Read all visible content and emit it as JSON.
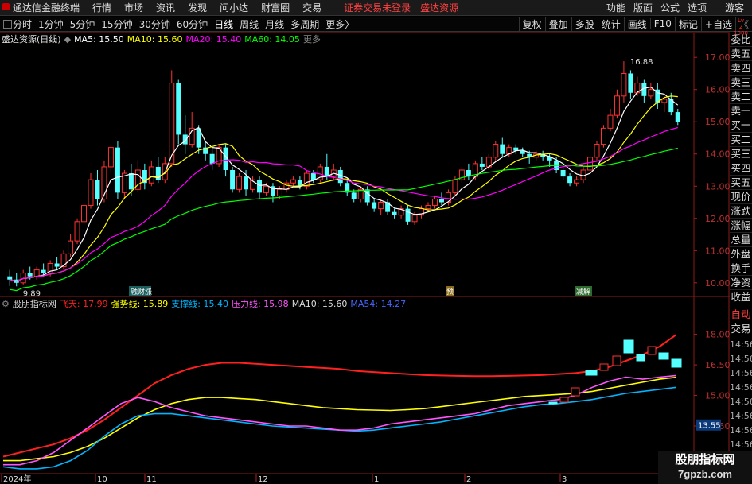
{
  "menu": {
    "app_title": "通达信金融终端",
    "items": [
      "行情",
      "市场",
      "资讯",
      "发现",
      "问小达",
      "财富圈",
      "交易"
    ],
    "security_warning": "证券交易未登录",
    "broker": "盛达资源",
    "right_items": [
      "功能",
      "版面",
      "公式",
      "选项"
    ],
    "guest": "游客"
  },
  "toolbar": {
    "periods": [
      "分时",
      "1分钟",
      "5分钟",
      "15分钟",
      "30分钟",
      "60分钟",
      "日线",
      "周线",
      "月线",
      "多周期",
      "更多"
    ],
    "more_suffix": "〉",
    "active_period": "日线",
    "right_buttons": [
      "复权",
      "叠加",
      "多股",
      "统计",
      "画线",
      "F10",
      "标记",
      "+自选",
      "《"
    ]
  },
  "level2": [
    "Lv",
    "2",
    "1000"
  ],
  "main_legend": {
    "settings_icon": "gear-icon",
    "name": "盛达资源(日线)",
    "collapse_icon": "chevron-icon",
    "ma5_label": "MA5: 15.50",
    "ma10_label": "MA10: 15.60",
    "ma20_label": "MA20: 15.40",
    "ma60_label": "MA60: 14.05",
    "controls": "◇ ×"
  },
  "sub_legend": {
    "name": "股朋指标网",
    "feitian": "飞天: 17.99",
    "strong": "强势线: 15.89",
    "support": "支撑线: 15.40",
    "pressure": "压力线: 15.98",
    "ma10": "MA10: 15.60",
    "ma54": "MA54: 14.27",
    "controls": "◇ ×"
  },
  "side_panel": [
    "委比",
    "卖五",
    "卖四",
    "卖三",
    "卖二",
    "卖一",
    "买一",
    "买二",
    "买三",
    "买四",
    "买五",
    "现价",
    "涨跌",
    "涨幅",
    "总量",
    "外盘",
    "换手",
    "净资",
    "收益"
  ],
  "side_bottom": [
    "自动",
    "交易"
  ],
  "side_times": [
    "14:56",
    "14:56",
    "14:56",
    "14:56",
    "14:56",
    "14:56",
    "14:56",
    "14:56"
  ],
  "main_axis": [
    "17.00",
    "16.00",
    "15.00",
    "14.00",
    "13.00",
    "12.00",
    "11.00",
    "10.00"
  ],
  "sub_axis": [
    "18.00",
    "16.50",
    "15.00",
    "13.50",
    "12.00"
  ],
  "sub_current": "13.55",
  "annotations": {
    "high": "16.88",
    "low": "9.89",
    "marker1": "融财涨",
    "marker2": "预",
    "marker3": "减解"
  },
  "date_axis": [
    "2024年",
    "10",
    "11",
    "12",
    "1",
    "2",
    "3"
  ],
  "watermark": {
    "line1": "股朋指标网",
    "line2": "7gpzb.com"
  },
  "colors": {
    "up": "#ff3232",
    "down": "#54ffff",
    "ma5": "#ffffff",
    "ma10": "#ffff00",
    "ma20": "#ff00ff",
    "ma60": "#00ff00",
    "feitian": "#ff2020",
    "strong": "#ffff00",
    "support": "#00b4ff",
    "pressure": "#ff55ff"
  },
  "chart_data": [
    {
      "type": "candlestick",
      "title": "盛达资源(日线)",
      "y_range": [
        9.6,
        17.4
      ],
      "x_labels": [
        "2024年",
        "10",
        "11",
        "12",
        "1",
        "2",
        "3"
      ],
      "candles": [
        [
          10.2,
          10.1,
          10.4,
          9.9
        ],
        [
          10.1,
          10.0,
          10.3,
          9.89
        ],
        [
          10.0,
          10.3,
          10.4,
          9.95
        ],
        [
          10.3,
          10.2,
          10.5,
          10.1
        ],
        [
          10.2,
          10.4,
          10.5,
          10.1
        ],
        [
          10.4,
          10.3,
          10.6,
          10.2
        ],
        [
          10.3,
          10.6,
          10.7,
          10.2
        ],
        [
          10.6,
          10.5,
          10.8,
          10.4
        ],
        [
          10.5,
          10.9,
          11.0,
          10.4
        ],
        [
          10.9,
          11.3,
          11.5,
          10.8
        ],
        [
          11.3,
          11.9,
          12.0,
          11.2
        ],
        [
          11.9,
          12.4,
          12.6,
          11.7
        ],
        [
          12.4,
          13.2,
          13.4,
          12.3
        ],
        [
          13.2,
          12.6,
          13.5,
          12.4
        ],
        [
          12.6,
          13.6,
          13.8,
          12.5
        ],
        [
          13.6,
          14.2,
          14.3,
          13.4
        ],
        [
          14.2,
          12.8,
          14.4,
          12.6
        ],
        [
          12.8,
          13.4,
          13.5,
          12.6
        ],
        [
          13.4,
          12.9,
          13.7,
          12.7
        ],
        [
          12.9,
          13.5,
          13.8,
          12.8
        ],
        [
          13.5,
          13.1,
          13.7,
          12.9
        ],
        [
          13.1,
          13.6,
          13.8,
          13.0
        ],
        [
          13.6,
          13.2,
          13.9,
          13.1
        ],
        [
          13.2,
          13.7,
          13.9,
          13.1
        ],
        [
          13.7,
          16.2,
          16.6,
          13.6
        ],
        [
          16.2,
          14.6,
          16.3,
          14.3
        ],
        [
          14.6,
          14.3,
          15.2,
          14.0
        ],
        [
          14.3,
          14.8,
          15.3,
          14.2
        ],
        [
          14.8,
          14.2,
          14.9,
          14.0
        ],
        [
          14.2,
          14.0,
          14.4,
          13.8
        ],
        [
          14.0,
          13.7,
          14.2,
          13.5
        ],
        [
          13.7,
          14.2,
          14.3,
          13.6
        ],
        [
          14.2,
          13.5,
          14.3,
          13.3
        ],
        [
          13.5,
          12.9,
          13.6,
          12.8
        ],
        [
          12.9,
          13.3,
          13.4,
          12.8
        ],
        [
          13.3,
          12.9,
          13.5,
          12.7
        ],
        [
          12.9,
          13.2,
          13.3,
          12.8
        ],
        [
          13.2,
          12.8,
          13.3,
          12.6
        ],
        [
          12.8,
          13.0,
          13.1,
          12.7
        ],
        [
          13.0,
          12.7,
          13.1,
          12.5
        ],
        [
          12.7,
          12.9,
          13.0,
          12.6
        ],
        [
          12.9,
          13.1,
          13.2,
          12.8
        ],
        [
          13.1,
          13.2,
          13.3,
          13.0
        ],
        [
          13.2,
          13.0,
          13.3,
          12.9
        ],
        [
          13.0,
          13.4,
          13.5,
          12.9
        ],
        [
          13.4,
          13.2,
          13.5,
          13.1
        ],
        [
          13.2,
          13.6,
          13.7,
          13.1
        ],
        [
          13.6,
          13.3,
          14.0,
          13.2
        ],
        [
          13.3,
          13.5,
          13.7,
          13.2
        ],
        [
          13.5,
          13.1,
          13.6,
          13.0
        ],
        [
          13.1,
          12.8,
          13.2,
          12.7
        ],
        [
          12.8,
          12.6,
          12.9,
          12.5
        ],
        [
          12.6,
          12.9,
          13.0,
          12.5
        ],
        [
          12.9,
          12.5,
          13.0,
          12.4
        ],
        [
          12.5,
          12.3,
          12.6,
          12.2
        ],
        [
          12.3,
          12.5,
          12.6,
          12.1
        ],
        [
          12.5,
          12.2,
          12.6,
          12.1
        ],
        [
          12.2,
          12.1,
          12.3,
          12.0
        ],
        [
          12.1,
          12.3,
          12.4,
          12.0
        ],
        [
          12.3,
          11.9,
          12.4,
          11.8
        ],
        [
          11.9,
          12.1,
          12.2,
          11.8
        ],
        [
          12.1,
          12.3,
          12.4,
          12.0
        ],
        [
          12.3,
          12.4,
          12.5,
          12.2
        ],
        [
          12.4,
          12.6,
          12.7,
          12.3
        ],
        [
          12.6,
          12.5,
          12.8,
          12.4
        ],
        [
          12.5,
          12.8,
          12.9,
          12.4
        ],
        [
          12.8,
          13.2,
          13.3,
          12.7
        ],
        [
          13.2,
          13.5,
          13.6,
          13.1
        ],
        [
          13.5,
          13.3,
          13.7,
          13.2
        ],
        [
          13.3,
          13.7,
          13.8,
          13.2
        ],
        [
          13.7,
          13.6,
          13.9,
          13.5
        ],
        [
          13.6,
          13.9,
          14.0,
          13.5
        ],
        [
          13.9,
          14.3,
          14.4,
          13.8
        ],
        [
          14.3,
          14.0,
          14.5,
          13.9
        ],
        [
          14.0,
          14.2,
          14.3,
          13.9
        ],
        [
          14.2,
          14.1,
          14.3,
          14.0
        ],
        [
          14.1,
          14.0,
          14.2,
          13.9
        ],
        [
          14.0,
          13.9,
          14.1,
          13.7
        ],
        [
          13.9,
          14.0,
          14.1,
          13.8
        ],
        [
          14.0,
          13.9,
          14.1,
          13.8
        ],
        [
          13.9,
          13.8,
          14.0,
          13.6
        ],
        [
          13.8,
          13.5,
          13.9,
          13.4
        ],
        [
          13.5,
          13.3,
          13.6,
          13.2
        ],
        [
          13.3,
          13.1,
          13.4,
          13.0
        ],
        [
          13.1,
          13.2,
          13.3,
          13.0
        ],
        [
          13.2,
          13.5,
          13.6,
          13.1
        ],
        [
          13.5,
          13.9,
          14.0,
          13.4
        ],
        [
          13.9,
          14.3,
          14.4,
          13.8
        ],
        [
          14.3,
          14.8,
          14.9,
          14.2
        ],
        [
          14.8,
          15.2,
          15.4,
          14.7
        ],
        [
          15.2,
          15.8,
          16.0,
          15.1
        ],
        [
          15.8,
          16.5,
          16.88,
          15.6
        ],
        [
          16.5,
          15.9,
          16.6,
          15.7
        ],
        [
          15.9,
          16.2,
          16.4,
          15.8
        ],
        [
          16.2,
          15.8,
          16.3,
          15.6
        ],
        [
          15.8,
          16.0,
          16.2,
          15.7
        ],
        [
          16.0,
          15.6,
          16.2,
          15.4
        ],
        [
          15.6,
          15.7,
          15.8,
          15.3
        ],
        [
          15.7,
          15.3,
          15.9,
          15.2
        ],
        [
          15.3,
          15.0,
          15.4,
          14.9
        ]
      ]
    },
    {
      "type": "line",
      "title": "股朋指标网",
      "y_range": [
        11.2,
        19.0
      ],
      "series": [
        {
          "name": "飞天",
          "values": [
            12.0,
            12.2,
            12.4,
            12.6,
            12.9,
            13.3,
            13.8,
            14.4,
            15.0,
            15.6,
            16.0,
            16.3,
            16.5,
            16.6,
            16.6,
            16.55,
            16.5,
            16.45,
            16.4,
            16.35,
            16.3,
            16.2,
            16.15,
            16.1,
            16.05,
            16.0,
            15.98,
            15.96,
            15.95,
            15.95,
            15.96,
            15.98,
            16.0,
            16.05,
            16.1,
            16.2,
            16.4,
            16.7,
            17.0,
            17.4,
            17.99
          ]
        },
        {
          "name": "强势线",
          "values": [
            11.8,
            11.8,
            11.9,
            12.0,
            12.2,
            12.5,
            12.9,
            13.4,
            13.9,
            14.3,
            14.6,
            14.8,
            14.9,
            14.9,
            14.85,
            14.8,
            14.7,
            14.6,
            14.5,
            14.4,
            14.35,
            14.3,
            14.28,
            14.26,
            14.3,
            14.35,
            14.45,
            14.55,
            14.65,
            14.75,
            14.85,
            14.95,
            15.0,
            15.05,
            15.1,
            15.2,
            15.35,
            15.5,
            15.65,
            15.8,
            15.89
          ]
        },
        {
          "name": "支撑线",
          "values": [
            11.5,
            11.4,
            11.4,
            11.5,
            11.8,
            12.3,
            13.0,
            13.6,
            14.0,
            14.1,
            14.1,
            14.0,
            13.9,
            13.8,
            13.7,
            13.6,
            13.5,
            13.45,
            13.4,
            13.35,
            13.3,
            13.25,
            13.3,
            13.4,
            13.5,
            13.6,
            13.7,
            13.85,
            14.0,
            14.15,
            14.3,
            14.45,
            14.55,
            14.6,
            14.7,
            14.8,
            14.95,
            15.1,
            15.2,
            15.3,
            15.4
          ]
        },
        {
          "name": "压力线",
          "values": [
            11.6,
            11.6,
            11.8,
            12.2,
            12.8,
            13.4,
            14.0,
            14.6,
            14.9,
            14.7,
            14.4,
            14.2,
            14.0,
            13.9,
            13.8,
            13.7,
            13.6,
            13.5,
            13.5,
            13.4,
            13.3,
            13.3,
            13.4,
            13.6,
            13.7,
            13.8,
            13.9,
            14.0,
            14.1,
            14.3,
            14.5,
            14.6,
            14.7,
            14.8,
            15.0,
            15.4,
            15.7,
            15.9,
            15.8,
            15.9,
            15.98
          ]
        }
      ]
    }
  ]
}
